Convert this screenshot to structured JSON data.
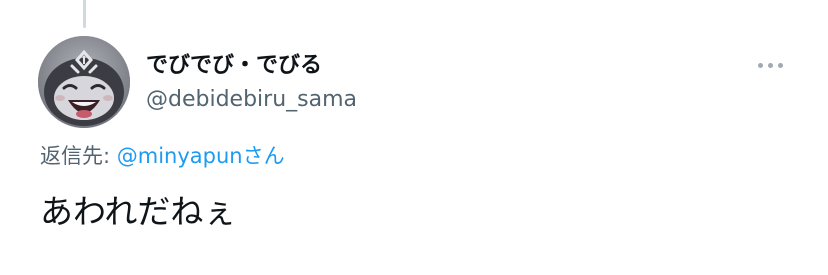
{
  "tweet": {
    "display_name": "でびでび・でびる",
    "handle": "@debidebiru_sama",
    "reply_prefix": "返信先: ",
    "reply_mention": "@minyapun",
    "reply_suffix": "さん",
    "text": "あわれだねぇ"
  },
  "icons": {
    "more": "more-horizontal-icon",
    "avatar": "profile-avatar"
  },
  "colors": {
    "text_primary": "#0f1419",
    "text_secondary": "#536471",
    "link": "#1d9bf0",
    "thread_line": "#cfd9de"
  }
}
